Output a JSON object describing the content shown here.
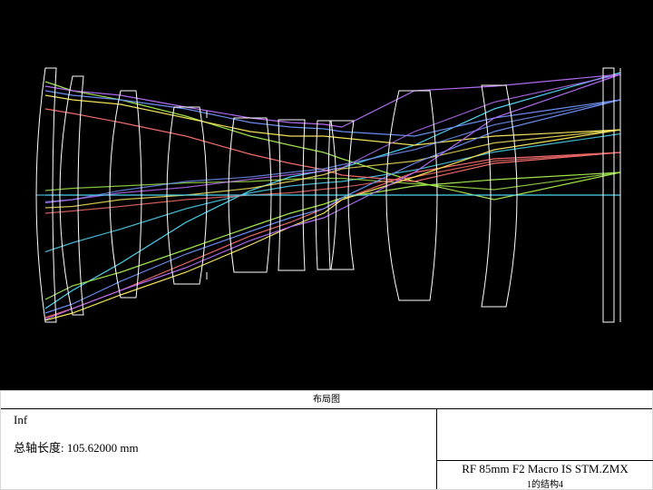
{
  "panel": {
    "title": "布局图",
    "field_line": "Inf",
    "axis_length_line": "总轴长度:  105.62000 mm",
    "file_name": "RF 85mm F2 Macro IS STM.ZMX",
    "config_label": "1的结构4"
  },
  "colors": {
    "background": "#000000",
    "lens_outline": "#ffffff",
    "field_rays": [
      "#4fd3f2",
      "#9fe24a",
      "#f06a6a",
      "#f3e25a",
      "#6a8cf0",
      "#b06af0"
    ]
  }
}
